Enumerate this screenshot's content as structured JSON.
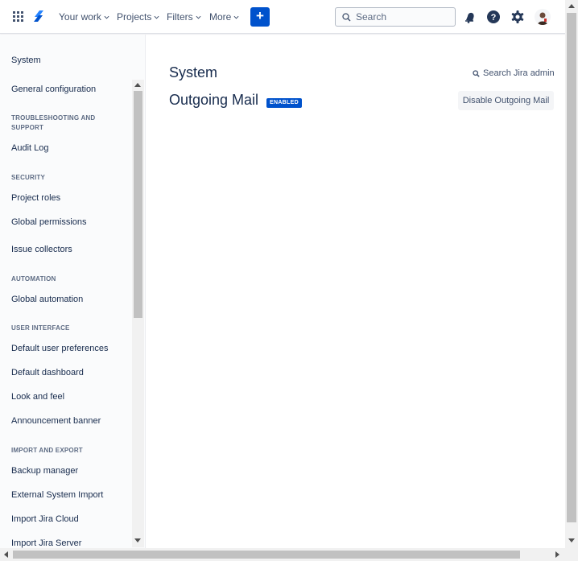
{
  "nav": {
    "your_work": "Your work",
    "projects": "Projects",
    "filters": "Filters",
    "more": "More",
    "create": "+",
    "search_placeholder": "Search",
    "icons": [
      "app-switcher-icon",
      "jira-logo-icon",
      "notifications-icon",
      "help-icon",
      "settings-icon"
    ]
  },
  "sidebar": {
    "title": "System",
    "general_configuration": "General configuration",
    "sections": {
      "troubleshooting": "TROUBLESHOOTING AND SUPPORT",
      "security": "SECURITY",
      "automation": "AUTOMATION",
      "user_interface": "USER INTERFACE",
      "import_export": "IMPORT AND EXPORT"
    },
    "items": {
      "audit_log": "Audit Log",
      "project_roles": "Project roles",
      "global_permissions": "Global permissions",
      "issue_collectors": "Issue collectors",
      "global_automation": "Global automation",
      "default_user_preferences": "Default user preferences",
      "default_dashboard": "Default dashboard",
      "look_and_feel": "Look and feel",
      "announcement_banner": "Announcement banner",
      "backup_manager": "Backup manager",
      "external_system_import": "External System Import",
      "import_jira_cloud": "Import Jira Cloud",
      "import_jira_server": "Import Jira Server"
    }
  },
  "main": {
    "title": "System",
    "search_admin": "Search Jira admin",
    "heading": "Outgoing Mail",
    "status_badge": "ENABLED",
    "disable_button": "Disable Outgoing Mail"
  },
  "colors": {
    "primary": "#0052cc",
    "text": "#172b4d",
    "subtle_text": "#42526e"
  }
}
